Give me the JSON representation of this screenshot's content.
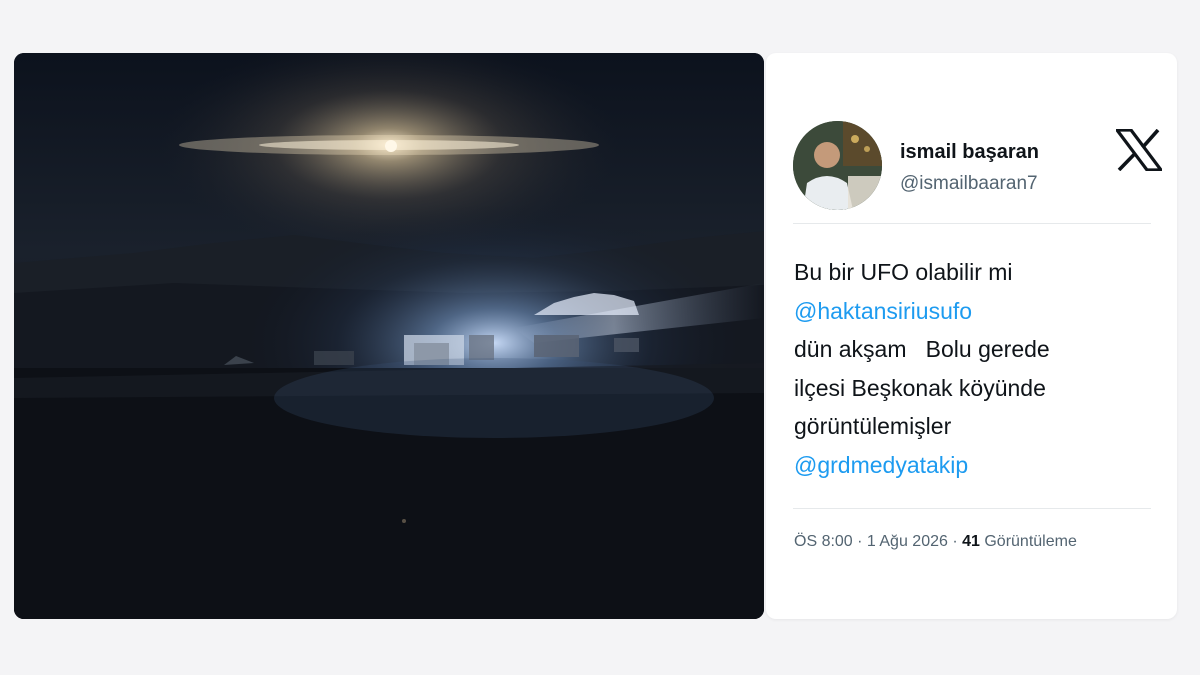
{
  "tweet": {
    "author": {
      "name": "ismail başaran",
      "handle": "@ismailbaaran7"
    },
    "text_lines": [
      {
        "text": "Bu bir UFO olabilir mi",
        "kind": "text"
      },
      {
        "text": "@haktansiriusufo",
        "kind": "mention"
      },
      {
        "text": "dün akşam   Bolu gerede",
        "kind": "text"
      },
      {
        "text": "ilçesi Beşkonak köyünde",
        "kind": "text"
      },
      {
        "text": "görüntülemişler",
        "kind": "text"
      },
      {
        "text": "@grdmedyatakip",
        "kind": "mention"
      }
    ],
    "meta": {
      "time": "ÖS 8:00",
      "separator": " · ",
      "date": "1 Ağu 2026",
      "views_count": "41",
      "views_label": " Görüntüleme"
    }
  },
  "icons": {
    "platform_logo": "x-logo-icon"
  },
  "colors": {
    "mention": "#1d9bf0",
    "text": "#0f1419",
    "secondary_text": "#536471",
    "page_background": "#f4f4f6"
  }
}
